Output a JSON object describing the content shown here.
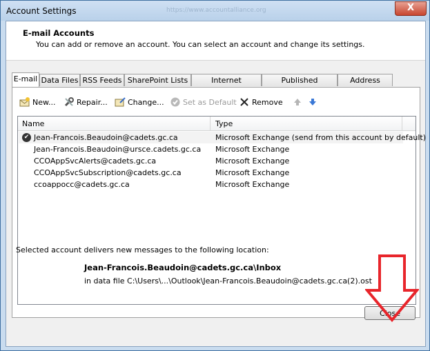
{
  "window": {
    "title": "Account Settings",
    "close_glyph": "X",
    "background_ghost_text": "https://www.accountalliance.org"
  },
  "header": {
    "title": "E-mail Accounts",
    "subtitle": "You can add or remove an account. You can select an account and change its settings."
  },
  "tabs": [
    {
      "label": "E-mail",
      "active": true
    },
    {
      "label": "Data Files"
    },
    {
      "label": "RSS Feeds"
    },
    {
      "label": "SharePoint Lists"
    },
    {
      "label": "Internet Calendars"
    },
    {
      "label": "Published Calendars"
    },
    {
      "label": "Address Books"
    }
  ],
  "toolbar": {
    "new_label": "New...",
    "repair_label": "Repair...",
    "change_label": "Change...",
    "default_label": "Set as Default",
    "remove_label": "Remove",
    "icons": [
      "new-mail-icon",
      "wrench-icon",
      "change-icon",
      "checkmark-icon",
      "x-icon",
      "up-arrow-icon",
      "down-arrow-icon"
    ]
  },
  "list": {
    "columns": [
      "Name",
      "Type"
    ],
    "rows": [
      {
        "name": "Jean-Francois.Beaudoin@cadets.gc.ca",
        "type": "Microsoft Exchange (send from this account by default)",
        "default": true
      },
      {
        "name": "Jean-Francois.Beaudoin@ursce.cadets.gc.ca",
        "type": "Microsoft Exchange"
      },
      {
        "name": "CCOAppSvcAlerts@cadets.gc.ca",
        "type": "Microsoft Exchange"
      },
      {
        "name": "CCOAppSvcSubscription@cadets.gc.ca",
        "type": "Microsoft Exchange"
      },
      {
        "name": "ccoappocc@cadets.gc.ca",
        "type": "Microsoft Exchange"
      }
    ]
  },
  "location": {
    "intro": "Selected account delivers new messages to the following location:",
    "inbox": "Jean-Francois.Beaudoin@cadets.gc.ca\\Inbox",
    "data_file": "in data file C:\\Users\\...\\Outlook\\Jean-Francois.Beaudoin@cadets.gc.ca(2).ost"
  },
  "footer": {
    "close_label": "Close"
  },
  "colors": {
    "annotation_arrow": "#e8252b",
    "title_bar": "#c6dbf1"
  }
}
